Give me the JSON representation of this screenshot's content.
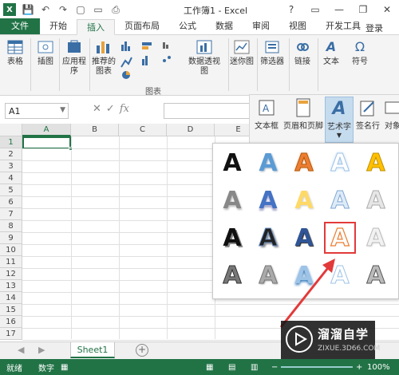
{
  "window": {
    "title": "工作簿1 - Excel",
    "app_icon": "X",
    "controls": [
      "?",
      "▭",
      "—",
      "❐",
      "✕"
    ]
  },
  "quick_access": {
    "icons": [
      "save-icon",
      "undo-icon",
      "redo-icon",
      "new-icon",
      "open-icon",
      "print-icon"
    ]
  },
  "tabs": [
    {
      "label": "文件"
    },
    {
      "label": "开始"
    },
    {
      "label": "插入"
    },
    {
      "label": "页面布局"
    },
    {
      "label": "公式"
    },
    {
      "label": "数据"
    },
    {
      "label": "审阅"
    },
    {
      "label": "视图"
    },
    {
      "label": "开发工具"
    }
  ],
  "login": "登录",
  "ribbon": {
    "table": "表格",
    "illustrations": "插图",
    "apps": "应用程序",
    "recommended_charts": "推荐的图表",
    "pivot_chart": "数据透视图",
    "charts_group": "图表",
    "sparklines": "迷你图",
    "filters": "筛选器",
    "links": "链接",
    "text": "文本",
    "symbols": "符号"
  },
  "formula_bar": {
    "name_box": "A1",
    "value": ""
  },
  "text_group": {
    "textbox": "文本框",
    "header_footer": "页眉和页脚",
    "wordart": "艺术字",
    "signature": "签名行",
    "object": "对象"
  },
  "columns": [
    "A",
    "B",
    "C",
    "D",
    "E"
  ],
  "rows": [
    "1",
    "2",
    "3",
    "4",
    "5",
    "6",
    "7",
    "8",
    "9",
    "10",
    "11",
    "12",
    "13",
    "14",
    "15",
    "16",
    "17"
  ],
  "wordart_glyph": "A",
  "sheets": [
    {
      "label": "Sheet1"
    }
  ],
  "status": {
    "ready": "就绪",
    "num": "数字",
    "zoom": "100%"
  },
  "watermark": {
    "name": "溜溜自学",
    "url": "ZIXUE.3D66.COM"
  },
  "colors": {
    "accent": "#217346",
    "highlight": "#e23a3a"
  }
}
